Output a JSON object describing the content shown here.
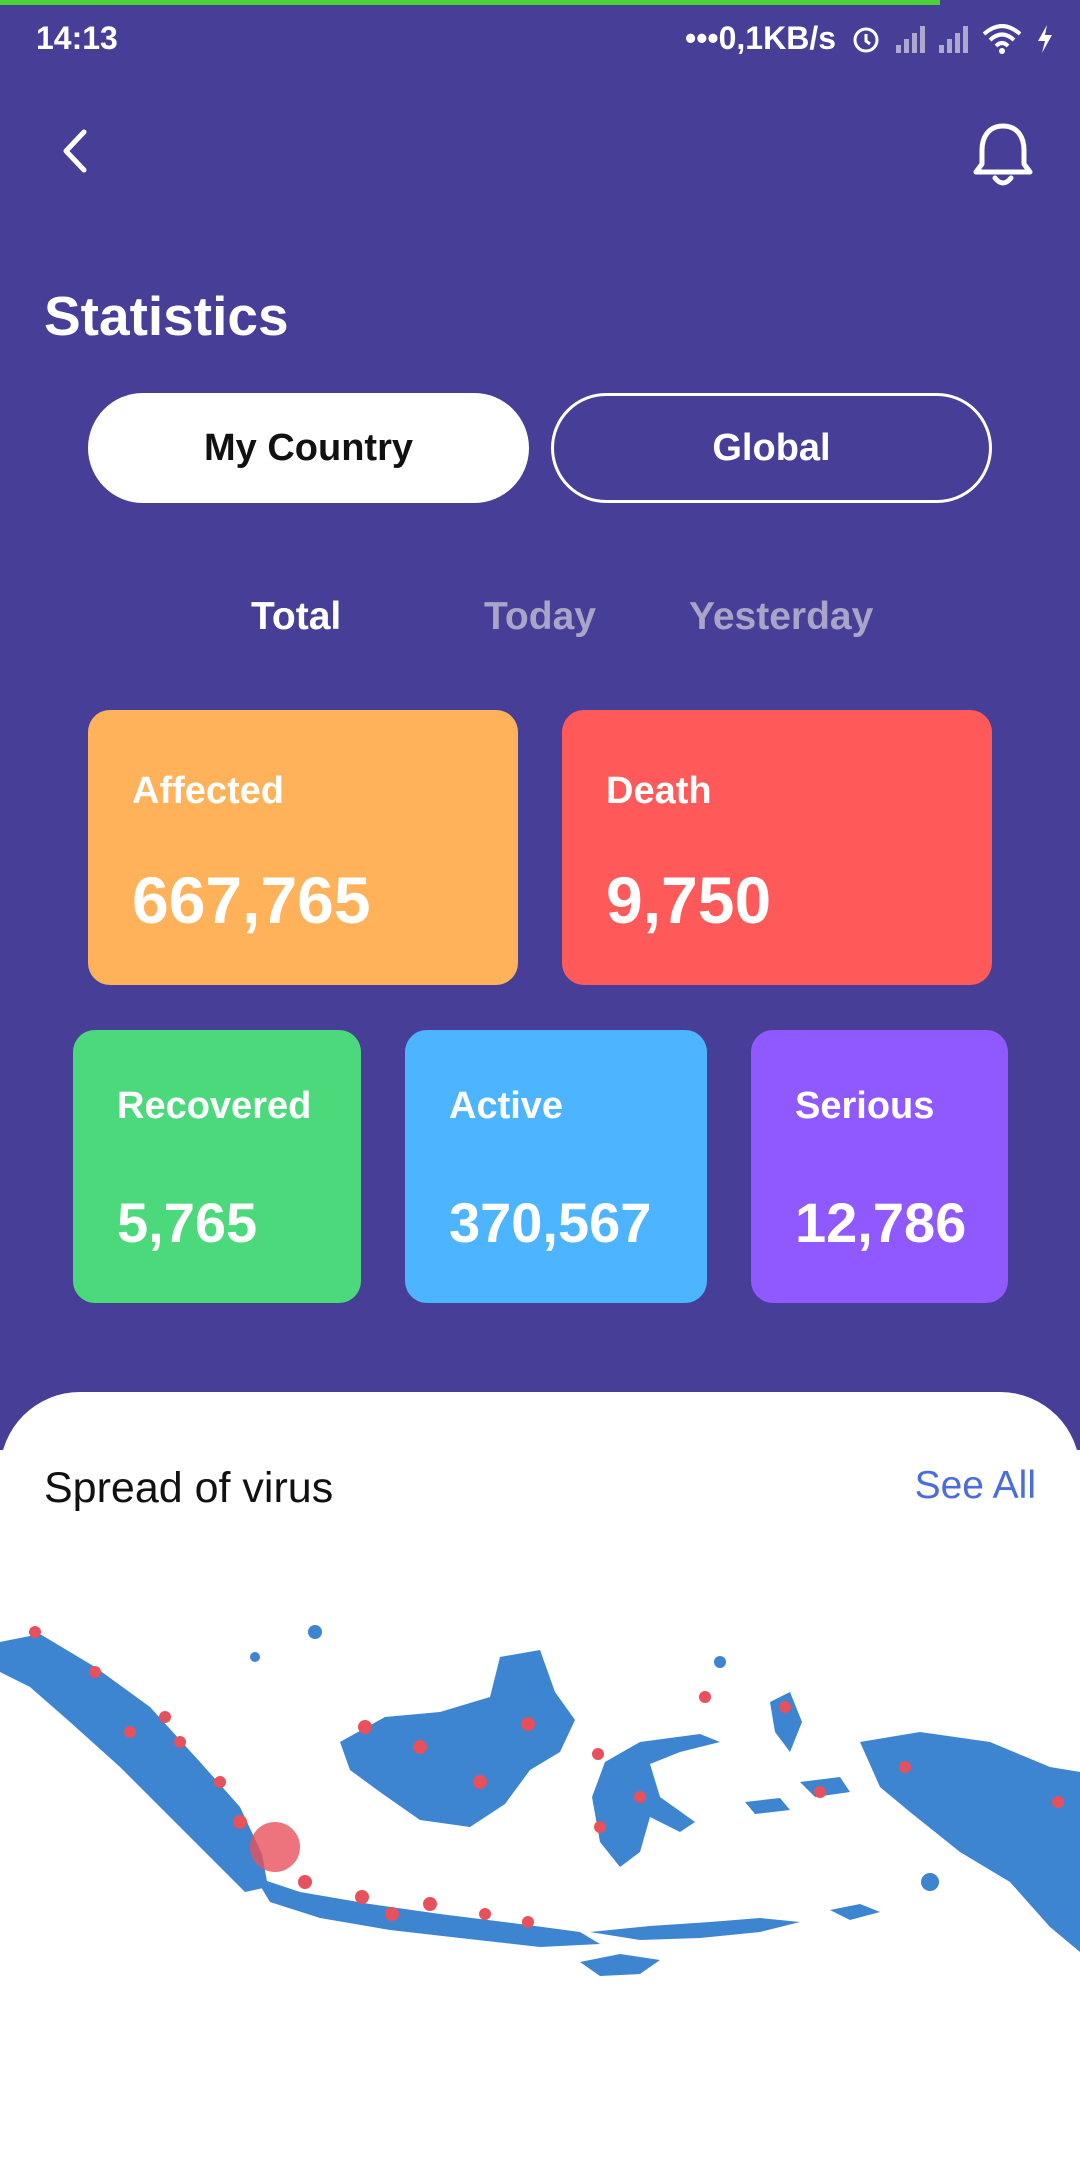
{
  "status_bar": {
    "time": "14:13",
    "net_speed": "•••0,1KB/s",
    "icons": [
      "alarm-icon",
      "signal-icon",
      "signal-icon",
      "wifi-icon",
      "charging-icon"
    ]
  },
  "header": {
    "back_icon": "chevron-left-icon",
    "bell_icon": "bell-icon",
    "title": "Statistics"
  },
  "segments": {
    "my_country": "My Country",
    "global": "Global",
    "selected": "My Country"
  },
  "tabs": {
    "total": "Total",
    "today": "Today",
    "yesterday": "Yesterday",
    "selected": "Total"
  },
  "cards": {
    "affected": {
      "label": "Affected",
      "value": "667,765",
      "color": "#FFB259"
    },
    "death": {
      "label": "Death",
      "value": "9,750",
      "color": "#FF5959"
    },
    "recovered": {
      "label": "Recovered",
      "value": "5,765",
      "color": "#4CD97B"
    },
    "active": {
      "label": "Active",
      "value": "370,567",
      "color": "#4DB5FF"
    },
    "serious": {
      "label": "Serious",
      "value": "12,786",
      "color": "#9059FF"
    }
  },
  "spread": {
    "title": "Spread of virus",
    "see_all": "See All"
  },
  "colors": {
    "background": "#473F97",
    "map_land": "#3D85D0",
    "hotspot": "#E8505B"
  }
}
